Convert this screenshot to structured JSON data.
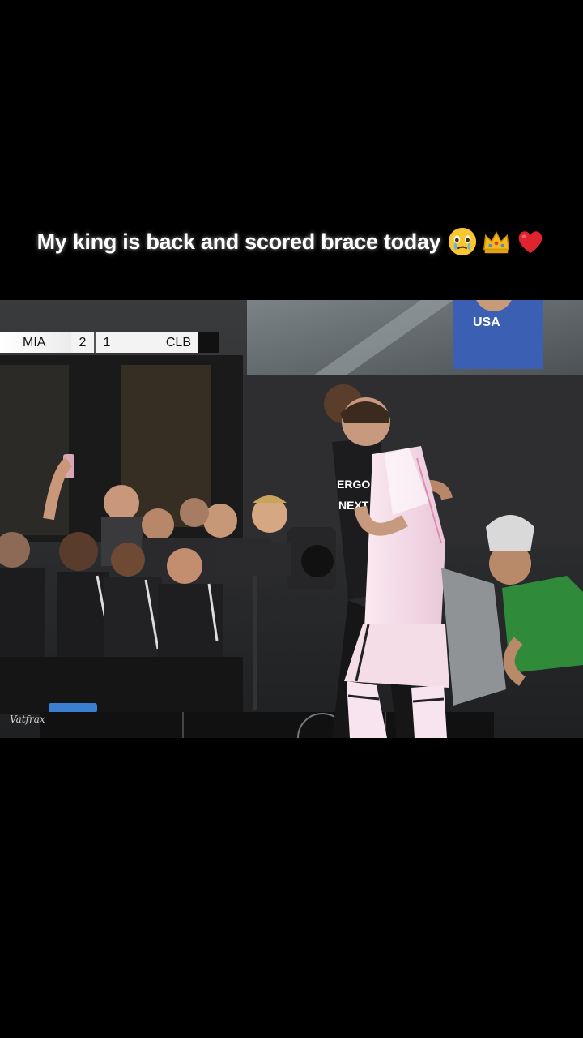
{
  "caption": {
    "text": "My king is back and scored brace today",
    "emojis": [
      "crying-face-emoji",
      "crown-emoji",
      "red-heart-emoji"
    ]
  },
  "scoreboard": {
    "home_team": "MIA",
    "home_score": "2",
    "away_score": "1",
    "away_team": "CLB"
  },
  "jersey_sponsor": {
    "line1": "ERGO",
    "line2": "NEXT"
  },
  "banner_text": "USA",
  "watermark": "Vatfrax",
  "colors": {
    "background": "#000000",
    "caption_text": "#ffffff",
    "scoreboard_bg": "#f3f3f3",
    "pink_kit": "#f4d9e6",
    "staff_kit": "#1c1c1e",
    "cameraman_vest": "#2f8a3a"
  }
}
